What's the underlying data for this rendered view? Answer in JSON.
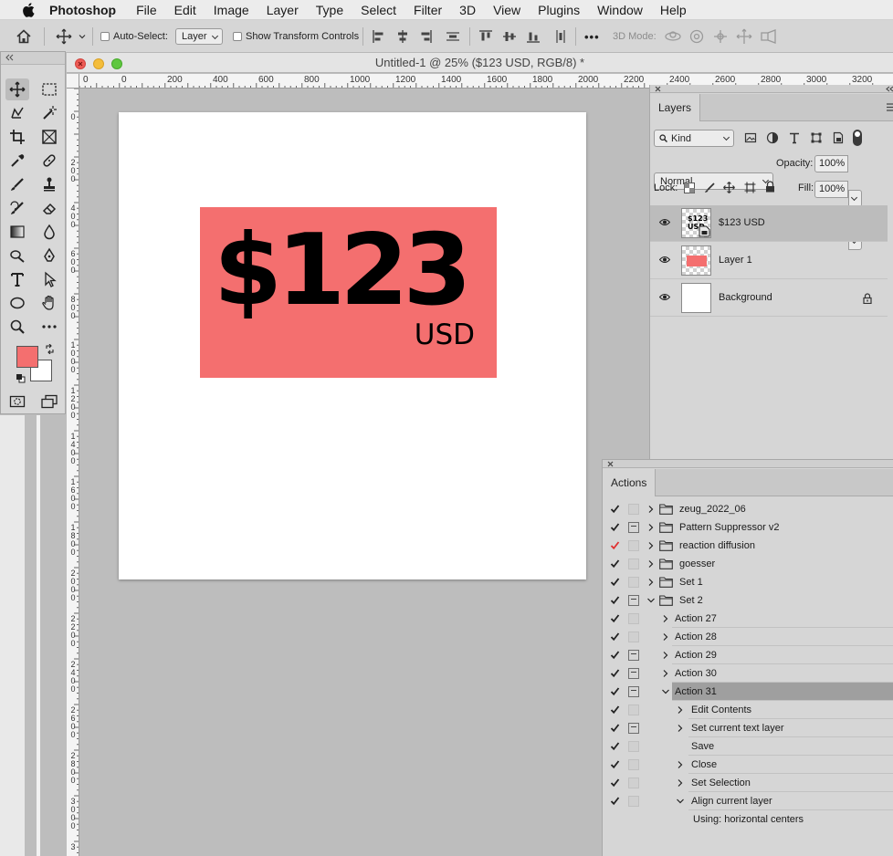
{
  "menubar": {
    "app_name": "Photoshop",
    "items": [
      "File",
      "Edit",
      "Image",
      "Layer",
      "Type",
      "Select",
      "Filter",
      "3D",
      "View",
      "Plugins",
      "Window",
      "Help"
    ]
  },
  "options_bar": {
    "auto_select_label": "Auto-Select:",
    "auto_select_checked": false,
    "auto_select_target": "Layer",
    "show_transform_label": "Show Transform Controls",
    "show_transform_checked": false,
    "more_label": "•••",
    "mode_3d_label": "3D Mode:"
  },
  "document": {
    "title": "Untitled-1 @ 25% ($123 USD, RGB/8) *",
    "ruler_h": [
      "0",
      "0",
      "200",
      "400",
      "600",
      "800",
      "1000",
      "1200",
      "1400",
      "1600",
      "1800",
      "2000",
      "2200",
      "2400",
      "2600",
      "2800",
      "3000",
      "3200"
    ],
    "ruler_v": [
      "0",
      "2\n0\n0",
      "4\n0\n0",
      "6\n0\n0",
      "8\n0\n0",
      "1\n0\n0\n0",
      "1\n2\n0\n0",
      "1\n4\n0\n0",
      "1\n6\n0\n0",
      "1\n8\n0\n0",
      "2\n0\n0\n0",
      "2\n2\n0\n0",
      "2\n4\n0\n0",
      "2\n6\n0\n0",
      "2\n8\n0\n0",
      "3\n0\n0\n0",
      "3"
    ],
    "price_text": "$123",
    "currency_text": "USD",
    "tag_color": "#f46f6f"
  },
  "tools": {
    "foreground_color": "#f46f6f",
    "background_color": "#ffffff"
  },
  "layers_panel": {
    "tab": "Layers",
    "filter_kind": "Kind",
    "blend_mode": "Normal",
    "opacity_label": "Opacity:",
    "opacity_value": "100%",
    "lock_label": "Lock:",
    "fill_label": "Fill:",
    "fill_value": "100%",
    "layers": [
      {
        "name": "$123 USD",
        "type": "smart-object",
        "selected": true,
        "visible": true
      },
      {
        "name": "Layer 1",
        "type": "pixel",
        "selected": false,
        "visible": true
      },
      {
        "name": "Background",
        "type": "background",
        "selected": false,
        "visible": true,
        "locked": true
      }
    ]
  },
  "actions_panel": {
    "tab": "Actions",
    "rows": [
      {
        "name": "zeug_2022_06",
        "kind": "set",
        "expanded": false,
        "checked": true,
        "dialog": false
      },
      {
        "name": "Pattern Suppressor v2",
        "kind": "set",
        "expanded": false,
        "checked": true,
        "dialog": true
      },
      {
        "name": "reaction diffusion",
        "kind": "set",
        "expanded": false,
        "checked": true,
        "check_color": "#e03030",
        "dialog": false
      },
      {
        "name": "goesser",
        "kind": "set",
        "expanded": false,
        "checked": true,
        "dialog": false
      },
      {
        "name": "Set 1",
        "kind": "set",
        "expanded": false,
        "checked": true,
        "dialog": false
      },
      {
        "name": "Set 2",
        "kind": "set",
        "expanded": true,
        "checked": true,
        "dialog": true
      },
      {
        "name": "Action 27",
        "kind": "action",
        "expanded": false,
        "checked": true,
        "dialog": false
      },
      {
        "name": "Action 28",
        "kind": "action",
        "expanded": false,
        "checked": true,
        "dialog": false
      },
      {
        "name": "Action 29",
        "kind": "action",
        "expanded": false,
        "checked": true,
        "dialog": true
      },
      {
        "name": "Action 30",
        "kind": "action",
        "expanded": false,
        "checked": true,
        "dialog": true
      },
      {
        "name": "Action 31",
        "kind": "action",
        "expanded": true,
        "checked": true,
        "dialog": true,
        "selected": true
      },
      {
        "name": "Edit Contents",
        "kind": "command",
        "expanded": false,
        "checked": true,
        "dialog": false
      },
      {
        "name": "Set current text layer",
        "kind": "command",
        "expanded": false,
        "checked": true,
        "dialog": true
      },
      {
        "name": "Save",
        "kind": "command",
        "has_chevron": false,
        "checked": true,
        "dialog": false
      },
      {
        "name": "Close",
        "kind": "command",
        "expanded": false,
        "checked": true,
        "dialog": false
      },
      {
        "name": "Set Selection",
        "kind": "command",
        "expanded": false,
        "checked": true,
        "dialog": false
      },
      {
        "name": "Align current layer",
        "kind": "command",
        "expanded": true,
        "checked": true,
        "dialog": false
      },
      {
        "name": "Using: horizontal centers",
        "kind": "detail"
      }
    ]
  }
}
